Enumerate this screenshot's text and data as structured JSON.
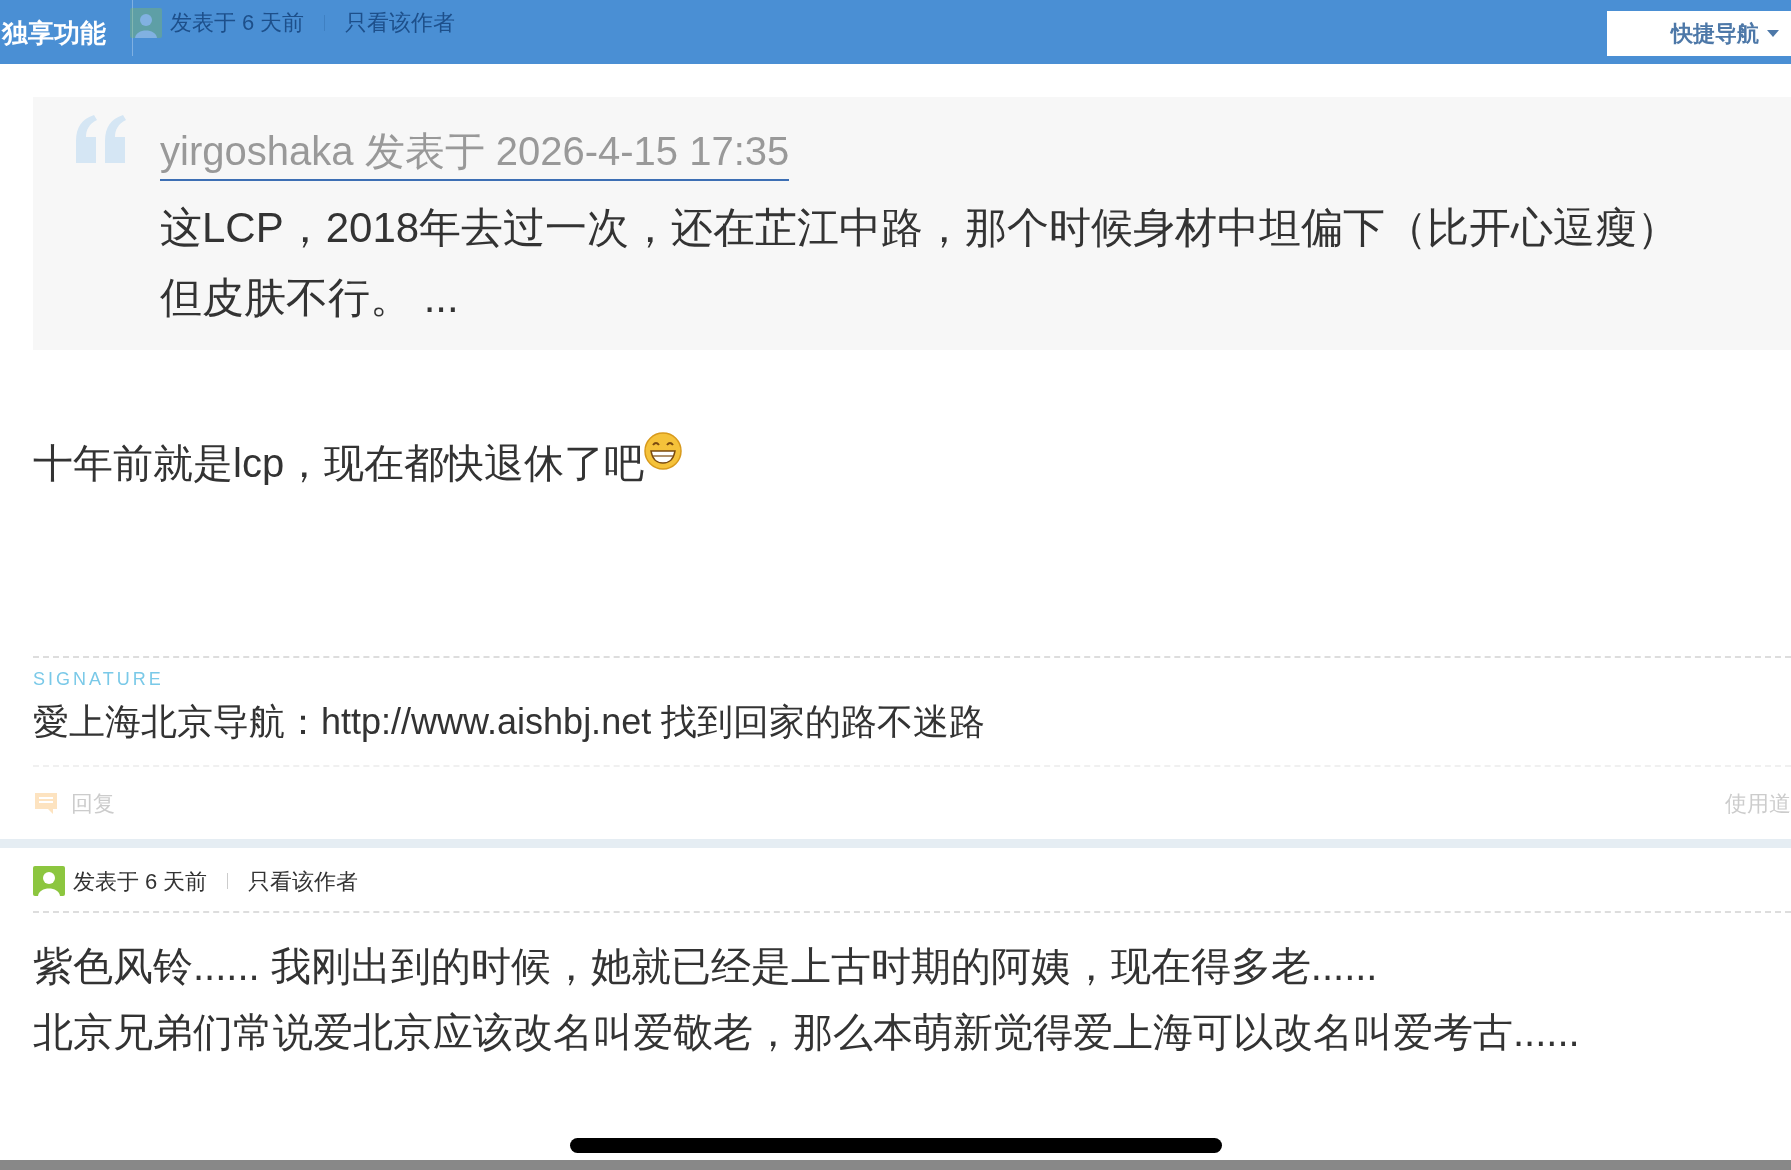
{
  "header": {
    "title": "独享功能",
    "ghost_meta": {
      "posted": "发表于 6 天前",
      "author_only": "只看该作者"
    },
    "nav_button": "快捷导航"
  },
  "posts": [
    {
      "quote": {
        "author_line": "yirgoshaka 发表于 2026-4-15 17:35",
        "lines": [
          "这LCP，2018年去过一次，还在芷江中路，那个时候身材中坦偏下（比开心逗瘦）",
          "但皮肤不行。 ..."
        ]
      },
      "body_lines": [
        {
          "text": "十年前就是lcp，现在都快退休了吧",
          "has_emoji": true
        }
      ],
      "signature": {
        "label": "SIGNATURE",
        "text": "愛上海北京导航：http://www.aishbj.net 找到回家的路不迷路"
      },
      "actions": {
        "reply": "回复",
        "right": "使用道"
      }
    },
    {
      "meta": {
        "posted": "发表于 6 天前",
        "author_only": "只看该作者"
      },
      "body_lines": [
        {
          "text": "紫色风铃...... 我刚出到的时候，她就已经是上古时期的阿姨，现在得多老......"
        },
        {
          "text": "北京兄弟们常说爱北京应该改名叫爱敬老，那么本萌新觉得爱上海可以改名叫爱考古......"
        }
      ]
    }
  ]
}
